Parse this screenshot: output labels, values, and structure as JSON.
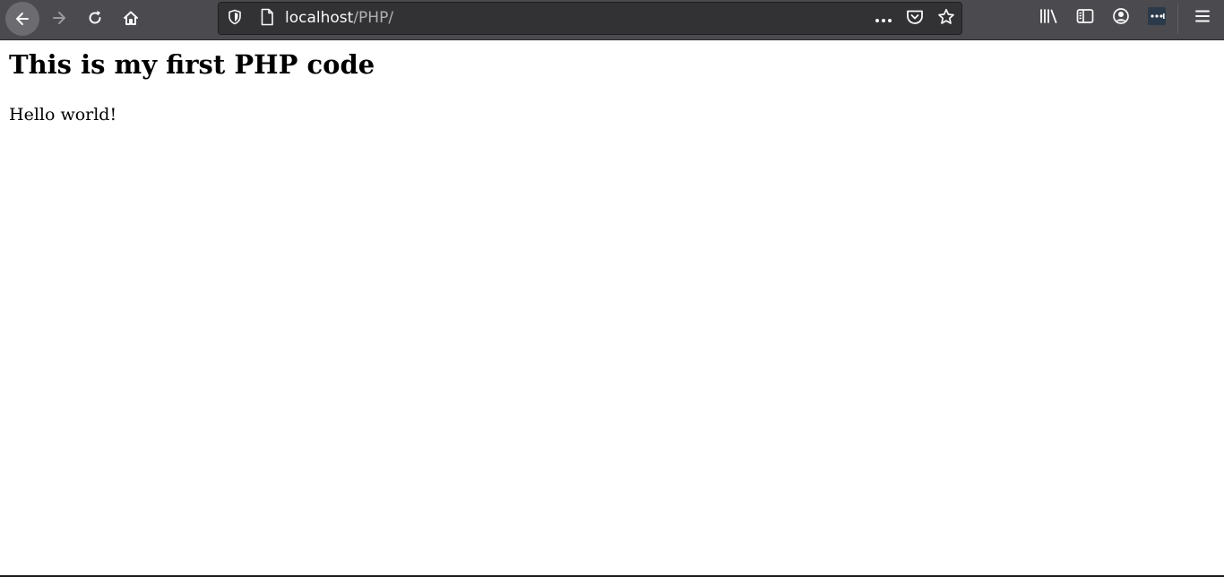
{
  "browser": {
    "url": {
      "host": "localhost",
      "path": "/PHP/"
    },
    "icons": {
      "back": "back-arrow-icon",
      "forward": "forward-arrow-icon",
      "reload": "reload-icon",
      "home": "home-icon",
      "tracking": "shield-icon",
      "page": "page-icon",
      "more": "more-actions-icon",
      "pocket": "pocket-icon",
      "bookmark": "star-icon",
      "library": "library-icon",
      "sidebar": "sidebar-icon",
      "account": "account-icon",
      "extension": "extension-icon",
      "menu": "hamburger-menu-icon"
    },
    "colors": {
      "toolbar": "#4a4a4f",
      "urlbar": "#323234",
      "page_background": "#ffffff"
    }
  },
  "page": {
    "heading": "This is my first PHP code",
    "paragraph": "Hello world!"
  }
}
